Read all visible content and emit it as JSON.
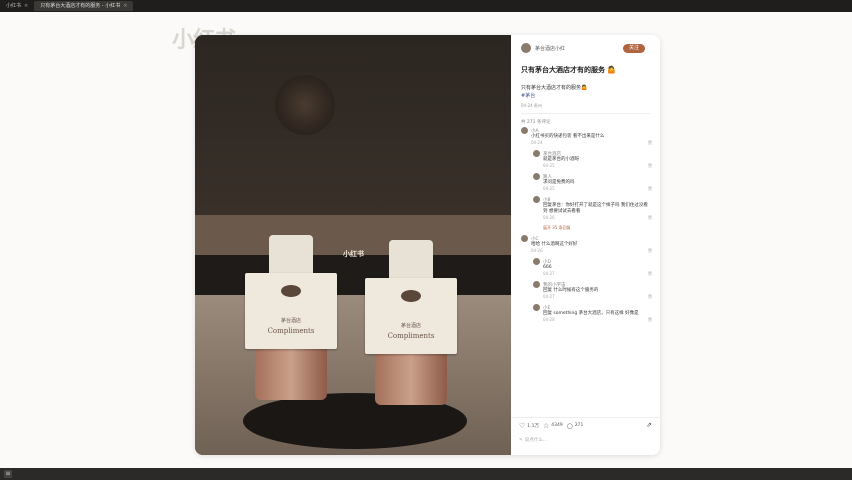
{
  "browser": {
    "tabs": [
      {
        "label": "小红书",
        "active": false
      },
      {
        "label": "只有茅台大酒店才有的服务 - 小红书",
        "active": true
      }
    ]
  },
  "watermark": "小红书",
  "photo": {
    "watermark": "小红书",
    "tag_text_cn": "茅台酒店",
    "tag_text_en": "Compliments"
  },
  "post": {
    "author": "茅台酒店小红",
    "follow_label": "关注",
    "title": "只有茅台大酒店才有的服务 🤷",
    "desc": "只有茅台大酒店才有的服务🤷",
    "tag": "#茅台",
    "meta": "04-24 贵州",
    "comment_count": "共 271 条评论"
  },
  "comments": [
    {
      "name": "小A",
      "text": "小红书买的快递包装 看不出来是什么",
      "time": "04-24",
      "likes": "赞",
      "reply": false
    },
    {
      "name": "茅台酒店",
      "text": "就是茅台的小酒呀",
      "time": "04-25",
      "likes": "赞",
      "reply": true
    },
    {
      "name": "路人",
      "text": "求问是免费的吗",
      "time": "04-25",
      "likes": "赞",
      "reply": true
    },
    {
      "name": "小B",
      "text": "回复茅台：你好打开了就是这个样子吗 我们住过没看到 想要试试去看看",
      "time": "04-26",
      "likes": "赞",
      "reply": true
    },
    {
      "name": "小C",
      "text": "哈哈 什么酒啊这个好好",
      "time": "04-26",
      "likes": "赞",
      "reply": false
    },
    {
      "name": "小D",
      "text": "666",
      "time": "04-27",
      "likes": "赞",
      "reply": true
    },
    {
      "name": "我的小宇宙",
      "text": "回复 什么时候有这个服务的",
      "time": "04-27",
      "likes": "赞",
      "reply": true
    },
    {
      "name": "小E",
      "text": "回复 something 茅台大酒店，只有这样 好像是",
      "time": "04-28",
      "likes": "赞",
      "reply": true
    }
  ],
  "more_replies": "展开 35 条回复",
  "actions": {
    "likes": "1.1万",
    "collects": "4349",
    "comments": "271"
  },
  "input_placeholder": "说点什么..."
}
